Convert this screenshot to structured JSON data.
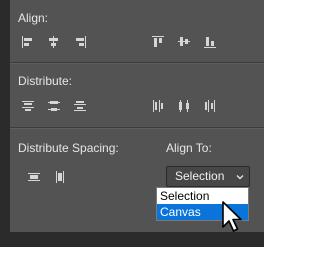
{
  "panel": {
    "align_label": "Align:",
    "distribute_label": "Distribute:",
    "distribute_spacing_label": "Distribute Spacing:",
    "align_to_label": "Align To:"
  },
  "align_icons": [
    "align-left-edges-icon",
    "align-horizontal-centers-icon",
    "align-right-edges-icon",
    "align-top-edges-icon",
    "align-vertical-centers-icon",
    "align-bottom-edges-icon"
  ],
  "distribute_icons": [
    "distribute-top-edges-icon",
    "distribute-vertical-centers-icon",
    "distribute-bottom-edges-icon",
    "distribute-left-edges-icon",
    "distribute-horizontal-centers-icon",
    "distribute-right-edges-icon"
  ],
  "spacing_icons": [
    "distribute-vertical-space-icon",
    "distribute-horizontal-space-icon"
  ],
  "align_to": {
    "selected_value": "Selection",
    "options": [
      "Selection",
      "Canvas"
    ],
    "highlighted_option": "Canvas"
  },
  "colors": {
    "panel_bg": "#535353",
    "frame_bg": "#2b2b2b",
    "icon_color": "#d6d6d6",
    "highlight": "#0a74da"
  }
}
